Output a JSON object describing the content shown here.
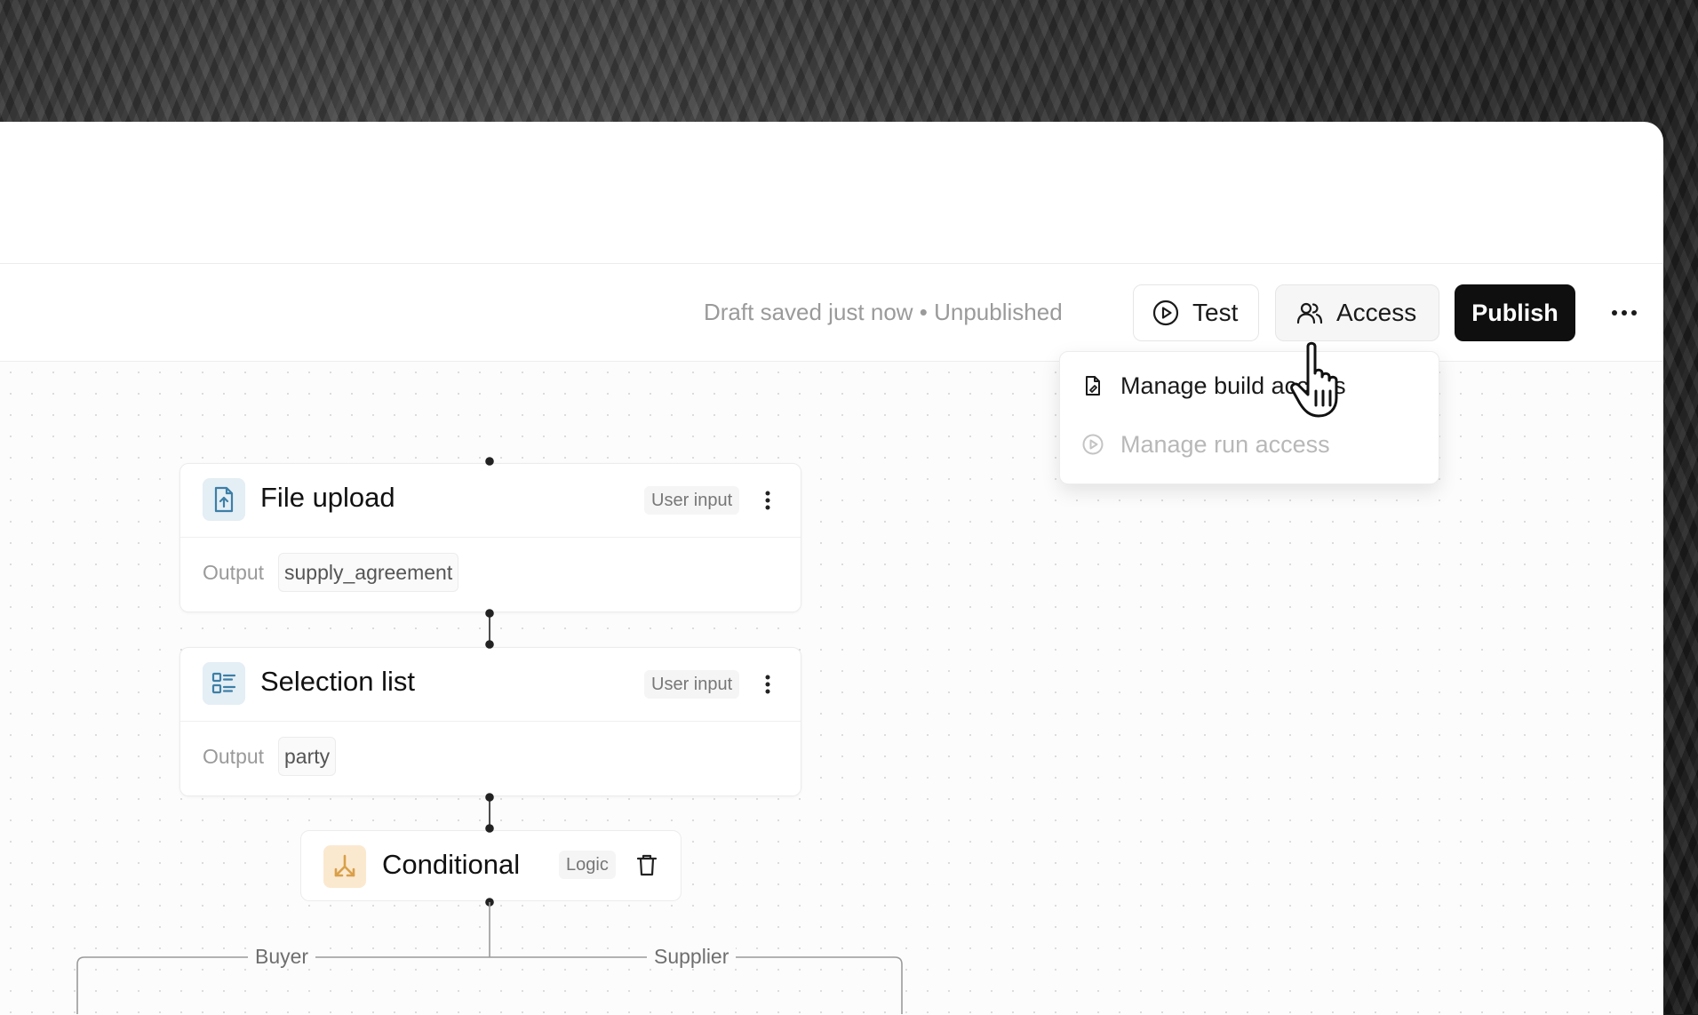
{
  "toolbar": {
    "status": "Draft saved just now • Unpublished",
    "test_label": "Test",
    "access_label": "Access",
    "publish_label": "Publish"
  },
  "access_menu": {
    "items": [
      {
        "label": "Manage build access",
        "icon": "build-file-icon",
        "enabled": true
      },
      {
        "label": "Manage run access",
        "icon": "play-circle-icon",
        "enabled": false
      }
    ]
  },
  "workflow": {
    "nodes": [
      {
        "title": "File upload",
        "badge": "User input",
        "output_label": "Output",
        "output_value": "supply_agreement",
        "icon": "file-upload-icon"
      },
      {
        "title": "Selection list",
        "badge": "User input",
        "output_label": "Output",
        "output_value": "party",
        "icon": "selection-list-icon"
      }
    ],
    "conditional": {
      "title": "Conditional",
      "badge": "Logic",
      "icon": "split-arrows-icon"
    },
    "branches": [
      "Buyer",
      "Supplier"
    ]
  },
  "colors": {
    "publish_bg": "#0f0f0f",
    "input_icon_bg": "#e4eef5",
    "logic_icon_bg": "#fbe9cf",
    "logic_icon_color": "#d9a04a"
  }
}
